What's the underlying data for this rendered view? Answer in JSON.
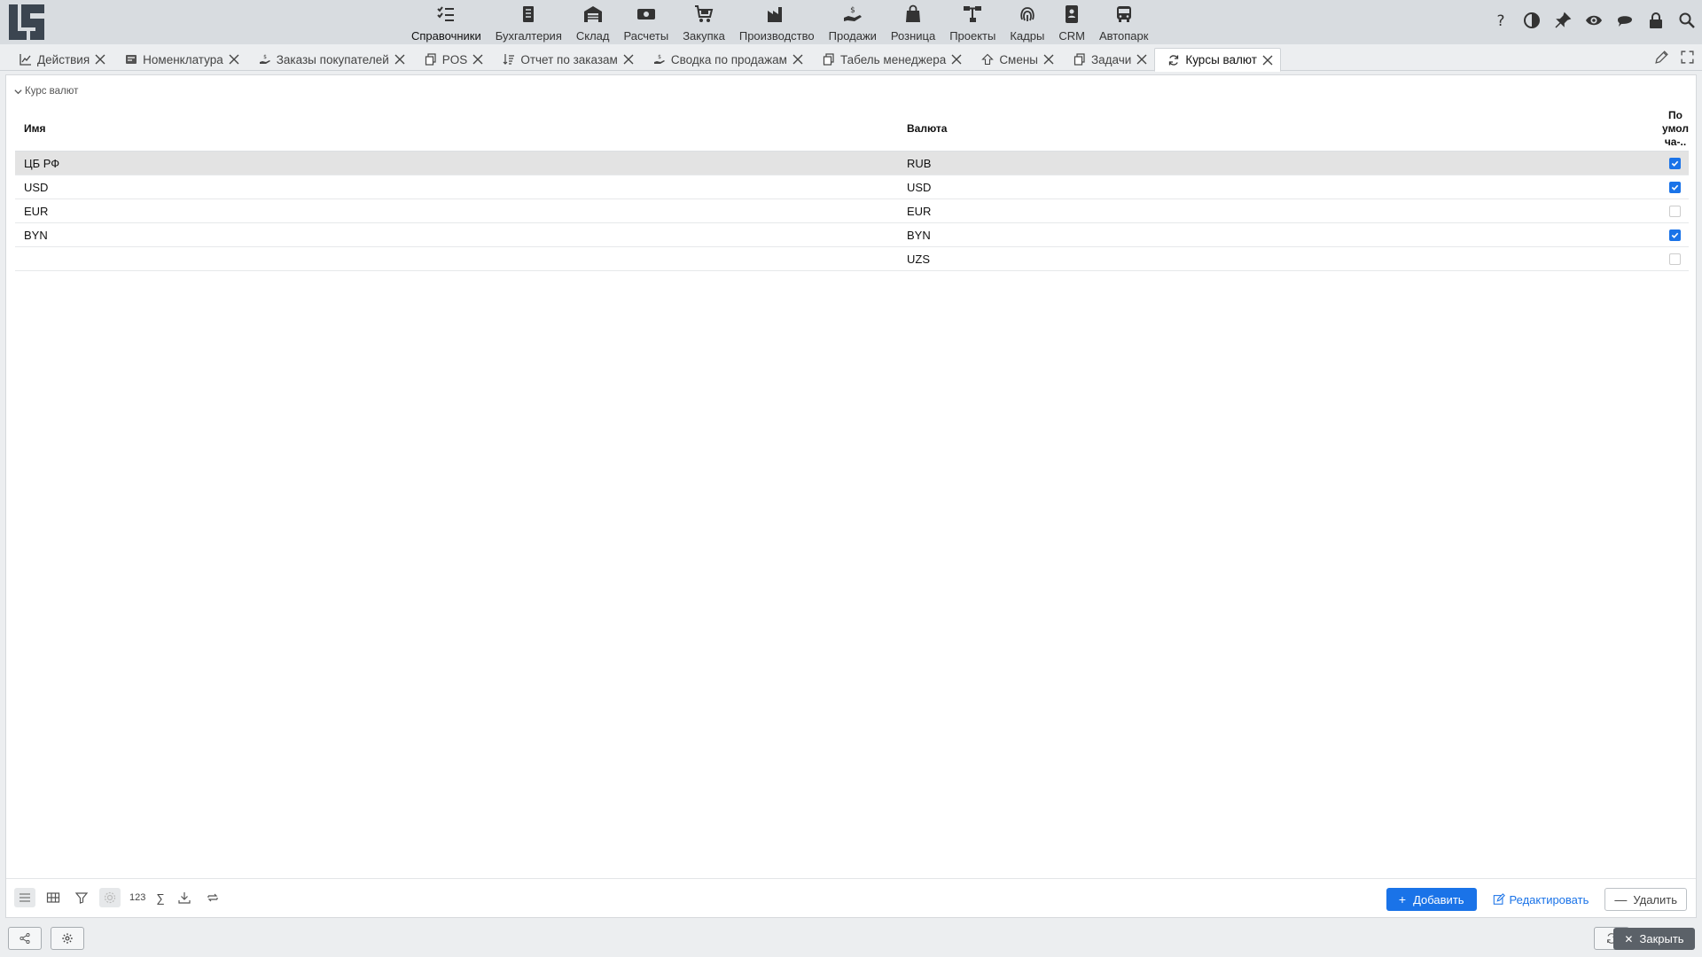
{
  "modules": [
    {
      "label": "Справочники",
      "icon": "checklist-icon",
      "active": true
    },
    {
      "label": "Бухгалтерия",
      "icon": "ledger-icon"
    },
    {
      "label": "Склад",
      "icon": "warehouse-icon"
    },
    {
      "label": "Расчеты",
      "icon": "money-icon"
    },
    {
      "label": "Закупка",
      "icon": "cart-icon"
    },
    {
      "label": "Производство",
      "icon": "factory-icon"
    },
    {
      "label": "Продажи",
      "icon": "hand-coin-icon"
    },
    {
      "label": "Розница",
      "icon": "shopping-bag-icon"
    },
    {
      "label": "Проекты",
      "icon": "project-tree-icon"
    },
    {
      "label": "Кадры",
      "icon": "fingerprint-icon"
    },
    {
      "label": "CRM",
      "icon": "contact-card-icon"
    },
    {
      "label": "Автопарк",
      "icon": "bus-icon"
    }
  ],
  "top_actions": [
    "help-icon",
    "contrast-icon",
    "pin-icon",
    "eye-icon",
    "chat-icon",
    "lock-icon",
    "search-icon"
  ],
  "tabs": [
    {
      "label": "Действия",
      "icon": "chart-icon"
    },
    {
      "label": "Номенклатура",
      "icon": "catalog-icon"
    },
    {
      "label": "Заказы покупателей",
      "icon": "hand-coin-icon"
    },
    {
      "label": "POS",
      "icon": "copy-icon"
    },
    {
      "label": "Отчет по заказам",
      "icon": "sort-icon"
    },
    {
      "label": "Сводка по продажам",
      "icon": "hand-coin-icon"
    },
    {
      "label": "Табель менеджера",
      "icon": "copy-icon"
    },
    {
      "label": "Смены",
      "icon": "shift-icon"
    },
    {
      "label": "Задачи",
      "icon": "copy-icon"
    },
    {
      "label": "Курсы валют",
      "icon": "refresh-icon",
      "active": true
    }
  ],
  "section_title": "Курс валют",
  "columns": {
    "name": "Имя",
    "currency": "Валюта",
    "default": "По умол ча-.."
  },
  "rows": [
    {
      "name": "ЦБ РФ",
      "currency": "RUB",
      "default": true
    },
    {
      "name": "USD",
      "currency": "USD",
      "default": true
    },
    {
      "name": "EUR",
      "currency": "EUR",
      "default": false
    },
    {
      "name": "BYN",
      "currency": "BYN",
      "default": true
    },
    {
      "name": "",
      "currency": "UZS",
      "default": false
    }
  ],
  "selected_row": 0,
  "toolbar": {
    "count_label": "123",
    "sum_label": "∑",
    "add_label": "Добавить",
    "edit_label": "Редактировать",
    "delete_label": "Удалить"
  },
  "footer": {
    "close_label": "Закрыть"
  },
  "colors": {
    "accent": "#1a73e8",
    "topbar": "#d8dce0",
    "close_button": "#5b6168"
  }
}
